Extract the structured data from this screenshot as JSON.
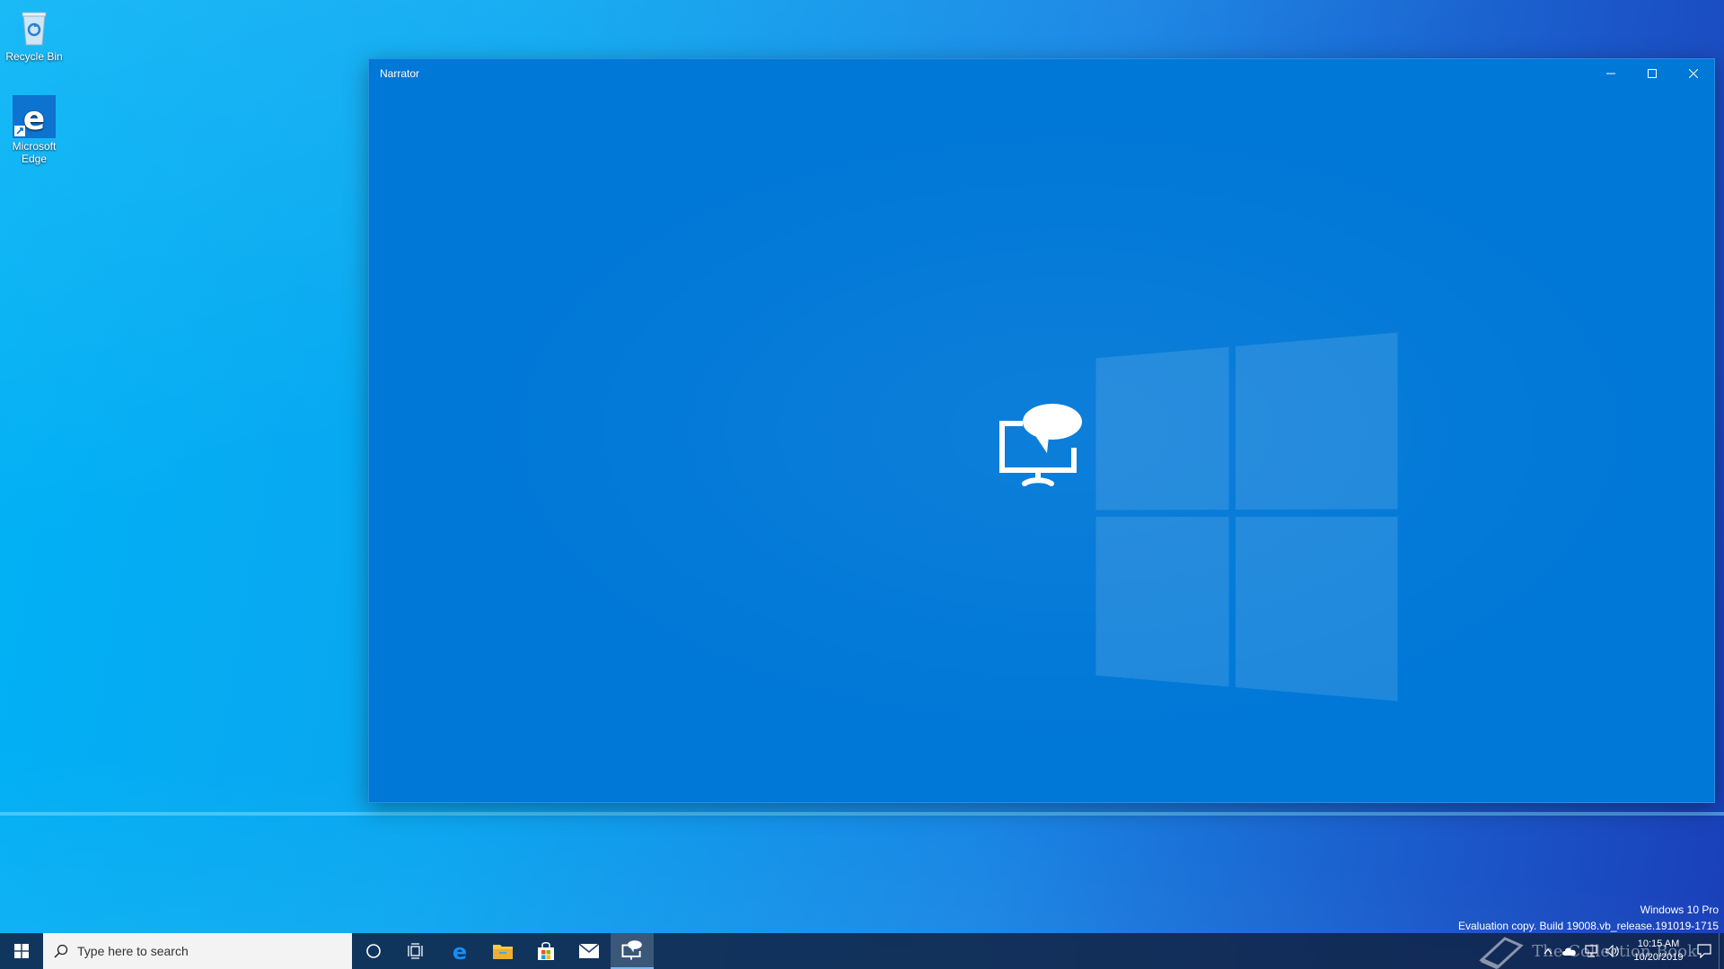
{
  "desktop": {
    "icons": [
      {
        "label": "Recycle Bin",
        "icon": "recycle-bin-icon"
      },
      {
        "label": "Microsoft Edge",
        "icon": "edge-icon"
      }
    ],
    "watermark": {
      "line1": "Windows 10 Pro",
      "line2": "Evaluation copy. Build 19008.vb_release.191019-1715"
    },
    "overlay_text": "The Collection Book"
  },
  "window": {
    "title": "Narrator",
    "buttons": {
      "minimize": "minimize-icon",
      "maximize": "maximize-icon",
      "close": "close-icon"
    },
    "hero_icon": "narrator-icon",
    "accent": "#0078d7"
  },
  "taskbar": {
    "search_placeholder": "Type here to search",
    "pinned": [
      "cortana-icon",
      "task-view-icon",
      "edge-icon",
      "file-explorer-icon",
      "store-icon",
      "mail-icon",
      "narrator-icon"
    ],
    "active": "narrator-icon",
    "clock": {
      "time": "10:15 AM",
      "date": "10/20/2019"
    }
  }
}
